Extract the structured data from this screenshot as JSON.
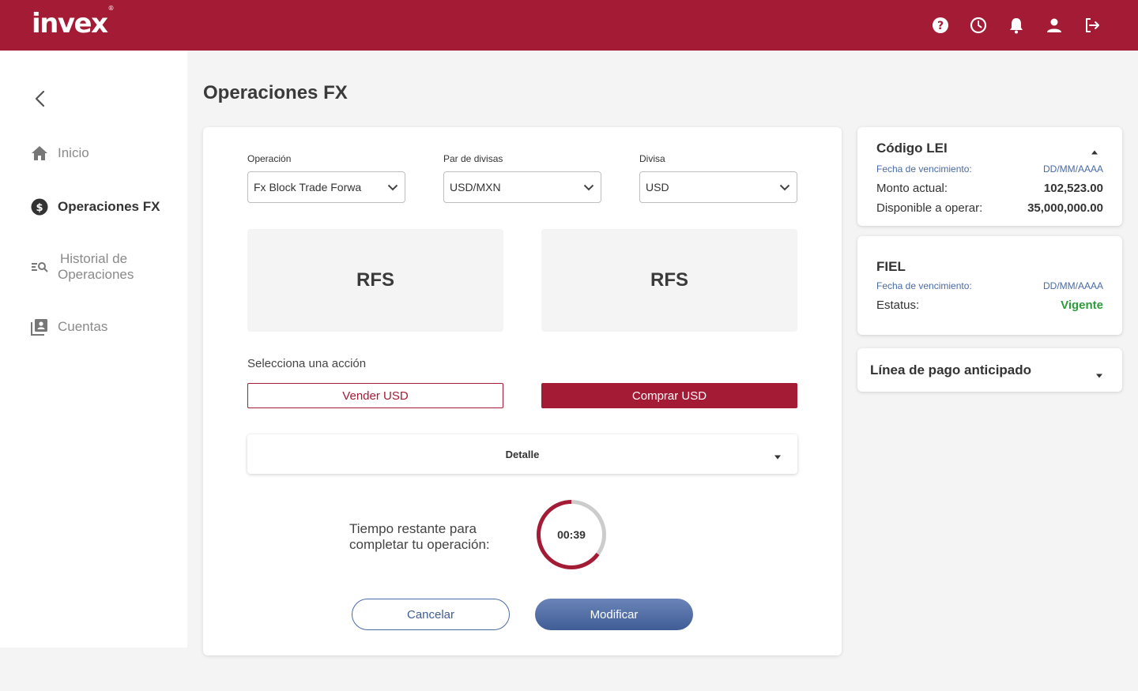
{
  "header": {
    "logo": "invex",
    "logo_mark": "®",
    "icons": [
      "help-icon",
      "history-clock-icon",
      "notifications-bell-icon",
      "user-icon",
      "logout-icon"
    ]
  },
  "sidebar": {
    "items": [
      {
        "label": "Inicio",
        "icon": "home-icon"
      },
      {
        "label": "Operaciones FX",
        "icon": "dollar-circle-icon"
      },
      {
        "label": "Historial de",
        "label2": "Operaciones",
        "icon": "search-list-icon"
      },
      {
        "label": "Cuentas",
        "icon": "accounts-icon"
      }
    ]
  },
  "page": {
    "title": "Operaciones FX"
  },
  "form": {
    "operacion": {
      "label": "Operación",
      "value": "Fx Block Trade Forwa"
    },
    "par": {
      "label": "Par de divisas",
      "value": "USD/MXN"
    },
    "divisa": {
      "label": "Divisa",
      "value": "USD"
    }
  },
  "rfs": {
    "left": "RFS",
    "right": "RFS"
  },
  "actions": {
    "label": "Selecciona una acción",
    "sell": "Vender USD",
    "buy": "Comprar USD"
  },
  "detalle": {
    "label": "Detalle"
  },
  "timer": {
    "text_line1": "Tiempo restante para",
    "text_line2": "completar tu operación:",
    "value": "00:39",
    "remaining_fraction": 0.65
  },
  "buttons": {
    "cancel": "Cancelar",
    "modify": "Modificar"
  },
  "lei": {
    "title": "Código LEI",
    "fecha_label": "Fecha de vencimiento:",
    "fecha_value": "DD/MM/AAAA",
    "monto_label": "Monto actual:",
    "monto_value": "102,523.00",
    "disp_label": "Disponible a operar:",
    "disp_value": "35,000,000.00"
  },
  "fiel": {
    "title": "FIEL",
    "fecha_label": "Fecha de vencimiento:",
    "fecha_value": "DD/MM/AAAA",
    "estatus_label": "Estatus:",
    "estatus_value": "Vigente"
  },
  "linea": {
    "title": "Línea de pago anticipado"
  },
  "colors": {
    "brand": "#a31b35",
    "accent_blue": "#3f5d96",
    "status_green": "#2e9b3a"
  }
}
